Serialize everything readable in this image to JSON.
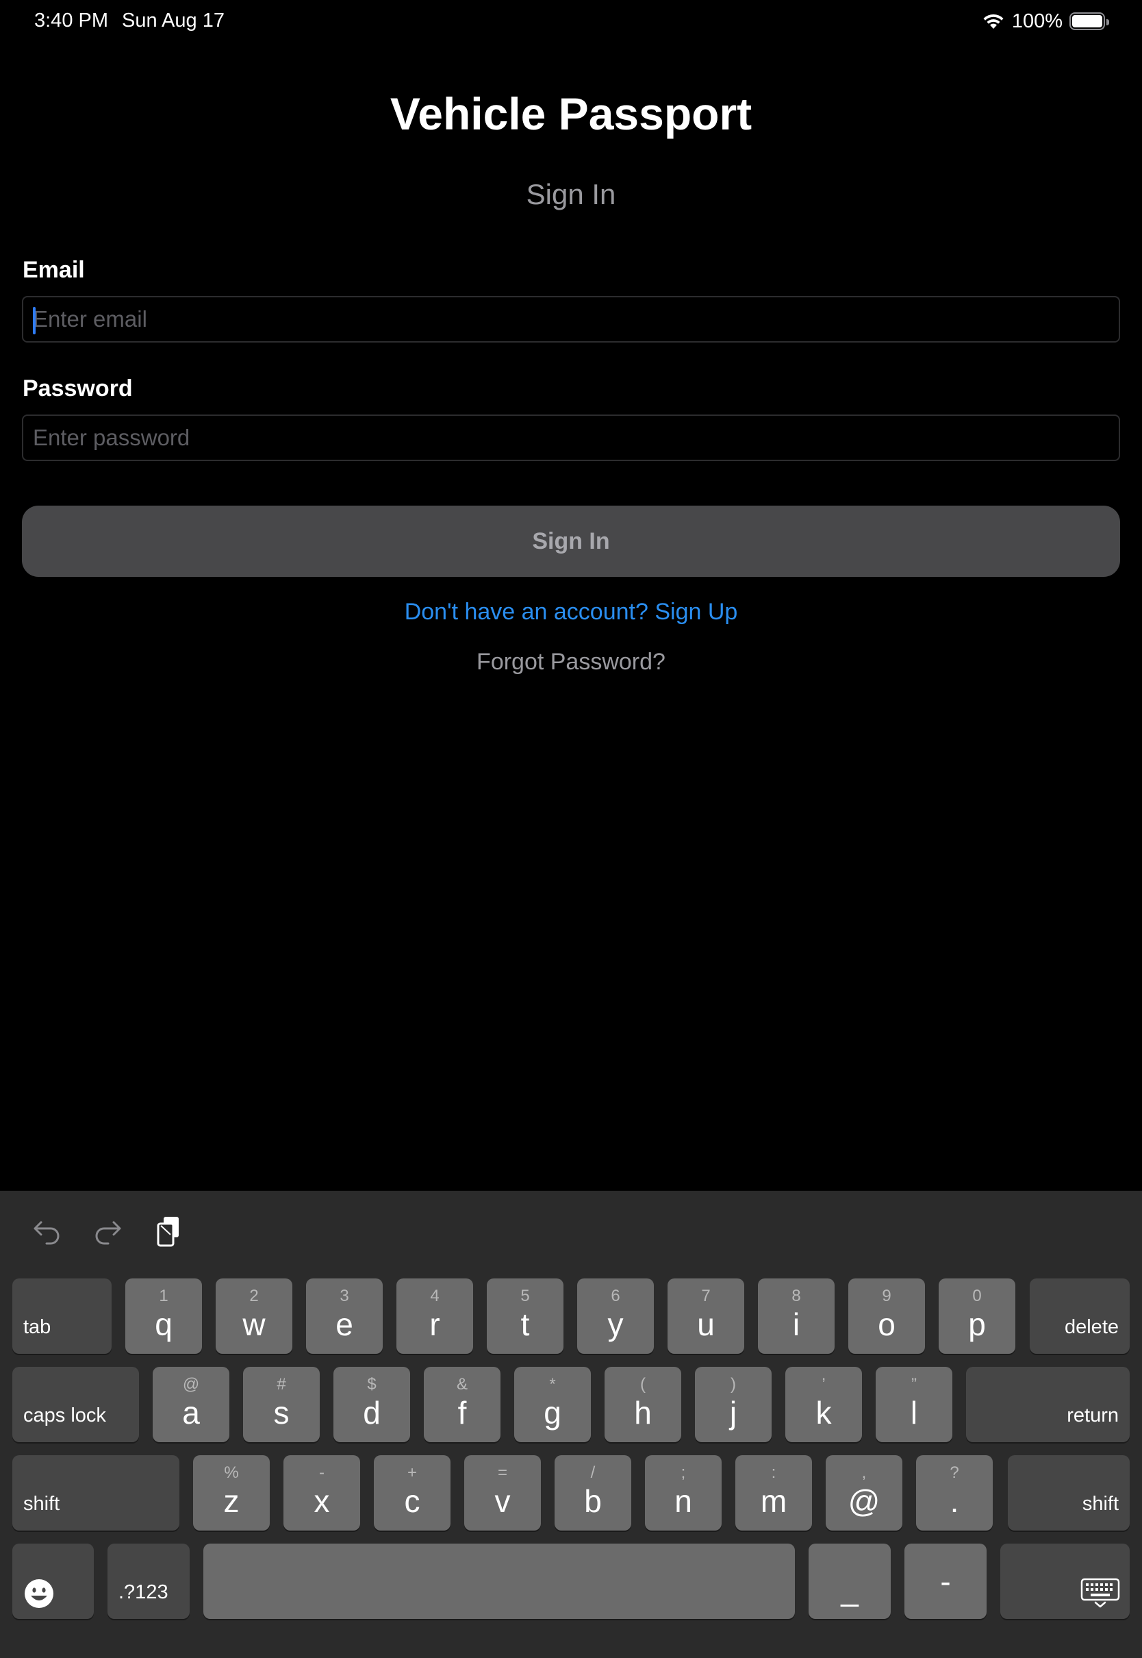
{
  "status_bar": {
    "time": "3:40 PM",
    "date": "Sun Aug 17",
    "battery": "100%",
    "icons": [
      "wifi-icon",
      "battery-icon"
    ]
  },
  "app": {
    "title": "Vehicle Passport",
    "subtitle": "Sign In"
  },
  "form": {
    "email_label": "Email",
    "email_placeholder": "Enter email",
    "email_value": "",
    "password_label": "Password",
    "password_placeholder": "Enter password",
    "password_value": "",
    "signin_label": "Sign In",
    "signup_link": "Don't have an account? Sign Up",
    "forgot_link": "Forgot Password?"
  },
  "keyboard": {
    "toolbar_icons": [
      "undo-icon",
      "redo-icon",
      "paste-icon"
    ],
    "row1": [
      {
        "hint": "1",
        "key": "q"
      },
      {
        "hint": "2",
        "key": "w"
      },
      {
        "hint": "3",
        "key": "e"
      },
      {
        "hint": "4",
        "key": "r"
      },
      {
        "hint": "5",
        "key": "t"
      },
      {
        "hint": "6",
        "key": "y"
      },
      {
        "hint": "7",
        "key": "u"
      },
      {
        "hint": "8",
        "key": "i"
      },
      {
        "hint": "9",
        "key": "o"
      },
      {
        "hint": "0",
        "key": "p"
      }
    ],
    "row2": [
      {
        "hint": "@",
        "key": "a"
      },
      {
        "hint": "#",
        "key": "s"
      },
      {
        "hint": "$",
        "key": "d"
      },
      {
        "hint": "&",
        "key": "f"
      },
      {
        "hint": "*",
        "key": "g"
      },
      {
        "hint": "(",
        "key": "h"
      },
      {
        "hint": ")",
        "key": "j"
      },
      {
        "hint": "’",
        "key": "k"
      },
      {
        "hint": "”",
        "key": "l"
      }
    ],
    "row3": [
      {
        "hint": "%",
        "key": "z"
      },
      {
        "hint": "-",
        "key": "x"
      },
      {
        "hint": "+",
        "key": "c"
      },
      {
        "hint": "=",
        "key": "v"
      },
      {
        "hint": "/",
        "key": "b"
      },
      {
        "hint": ";",
        "key": "n"
      },
      {
        "hint": ":",
        "key": "m"
      },
      {
        "hint": ",",
        "key": "@"
      },
      {
        "hint": "?",
        "key": "."
      }
    ],
    "tab": "tab",
    "delete": "delete",
    "caps_lock": "caps lock",
    "return": "return",
    "shift": "shift",
    "numbers": ".?123",
    "underscore": "_",
    "dash": "-",
    "bottom_icons": [
      "emoji-icon",
      "keyboard-hide-icon"
    ]
  }
}
